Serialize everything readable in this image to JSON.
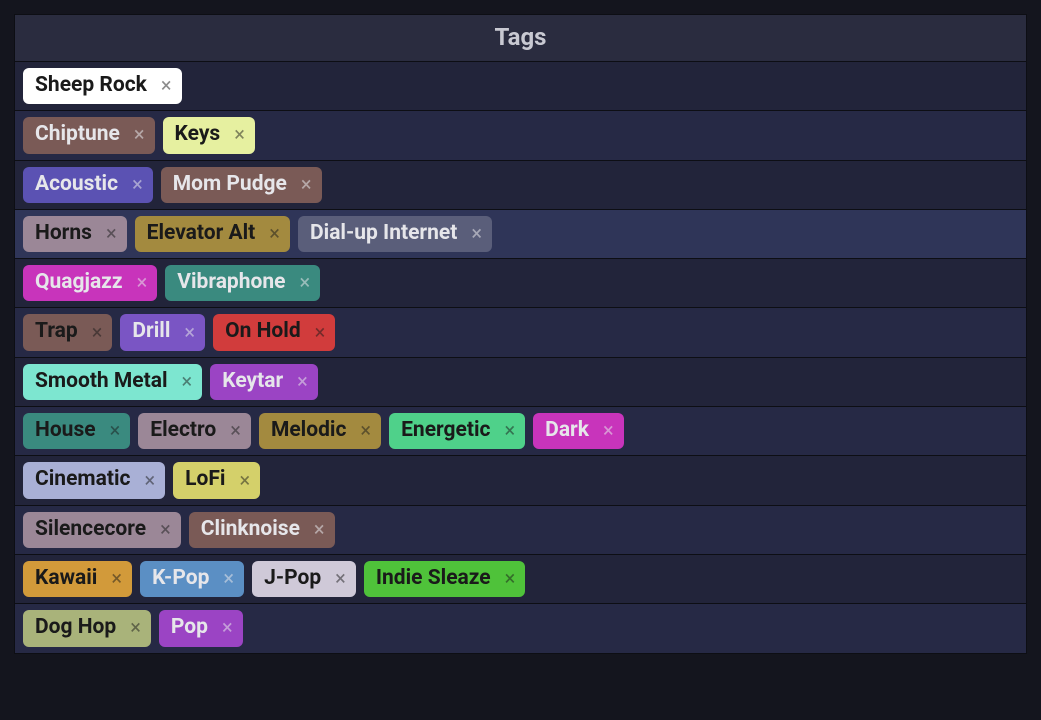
{
  "header": {
    "title": "Tags"
  },
  "rows": [
    {
      "highlight": false,
      "tags": [
        {
          "label": "Sheep Rock",
          "bg": "#ffffff",
          "tone": "light"
        }
      ]
    },
    {
      "highlight": false,
      "tags": [
        {
          "label": "Chiptune",
          "bg": "#7a5a56",
          "tone": "dark"
        },
        {
          "label": "Keys",
          "bg": "#e6f0a0",
          "tone": "light"
        }
      ]
    },
    {
      "highlight": false,
      "tags": [
        {
          "label": "Acoustic",
          "bg": "#5b52b3",
          "tone": "dark"
        },
        {
          "label": "Mom Pudge",
          "bg": "#7a5a56",
          "tone": "dark"
        }
      ]
    },
    {
      "highlight": true,
      "tags": [
        {
          "label": "Horns",
          "bg": "#9b8797",
          "tone": "light"
        },
        {
          "label": "Elevator Alt",
          "bg": "#a38a3f",
          "tone": "light"
        },
        {
          "label": "Dial-up Internet",
          "bg": "#5a5e7a",
          "tone": "dark"
        }
      ]
    },
    {
      "highlight": false,
      "tags": [
        {
          "label": "Quagjazz",
          "bg": "#c834bb",
          "tone": "dark"
        },
        {
          "label": "Vibraphone",
          "bg": "#3a8a7f",
          "tone": "dark"
        }
      ]
    },
    {
      "highlight": false,
      "tags": [
        {
          "label": "Trap",
          "bg": "#7a5a56",
          "tone": "light"
        },
        {
          "label": "Drill",
          "bg": "#7a55c4",
          "tone": "dark"
        },
        {
          "label": "On Hold",
          "bg": "#d13c3c",
          "tone": "light"
        }
      ]
    },
    {
      "highlight": false,
      "tags": [
        {
          "label": "Smooth Metal",
          "bg": "#7de6d0",
          "tone": "light"
        },
        {
          "label": "Keytar",
          "bg": "#9b44c4",
          "tone": "dark"
        }
      ]
    },
    {
      "highlight": false,
      "tags": [
        {
          "label": "House",
          "bg": "#3a8a7f",
          "tone": "light"
        },
        {
          "label": "Electro",
          "bg": "#9b8797",
          "tone": "light"
        },
        {
          "label": "Melodic",
          "bg": "#a38a3f",
          "tone": "light"
        },
        {
          "label": "Energetic",
          "bg": "#4fd18a",
          "tone": "light"
        },
        {
          "label": "Dark",
          "bg": "#c834bb",
          "tone": "dark"
        }
      ]
    },
    {
      "highlight": false,
      "tags": [
        {
          "label": "Cinematic",
          "bg": "#a9b0d6",
          "tone": "light"
        },
        {
          "label": "LoFi",
          "bg": "#d4d06a",
          "tone": "light"
        }
      ]
    },
    {
      "highlight": false,
      "tags": [
        {
          "label": "Silencecore",
          "bg": "#9b8797",
          "tone": "light"
        },
        {
          "label": "Clinknoise",
          "bg": "#7a5a56",
          "tone": "dark"
        }
      ]
    },
    {
      "highlight": false,
      "tags": [
        {
          "label": "Kawaii",
          "bg": "#d29a3a",
          "tone": "light"
        },
        {
          "label": "K-Pop",
          "bg": "#5b8fc4",
          "tone": "dark"
        },
        {
          "label": "J-Pop",
          "bg": "#cfc9d8",
          "tone": "light"
        },
        {
          "label": "Indie Sleaze",
          "bg": "#4fc23a",
          "tone": "light"
        }
      ]
    },
    {
      "highlight": false,
      "tags": [
        {
          "label": "Dog Hop",
          "bg": "#a9b37a",
          "tone": "light"
        },
        {
          "label": "Pop",
          "bg": "#9b44c4",
          "tone": "dark"
        }
      ]
    }
  ]
}
